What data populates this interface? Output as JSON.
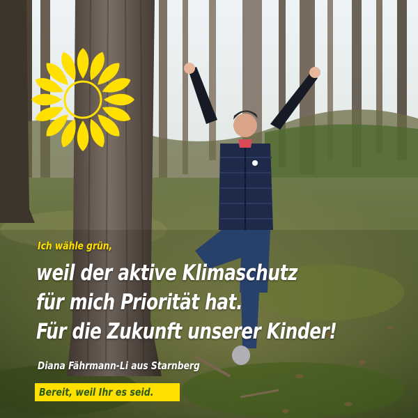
{
  "poster": {
    "kicker": "Ich wähle grün,",
    "headline": [
      "weil der aktive Klimaschutz",
      "für mich Priorität hat.",
      "Für die Zukunft unserer Kinder!"
    ],
    "author": "Diana Fährmann-Li aus Starnberg",
    "slogan": "Bereit, weil Ihr es seid."
  },
  "colors": {
    "accent_yellow": "#ffe000",
    "slogan_text": "#2a5a1f",
    "headline_text": "#ffffff"
  },
  "icons": {
    "logo": "sunflower-logo-icon"
  }
}
